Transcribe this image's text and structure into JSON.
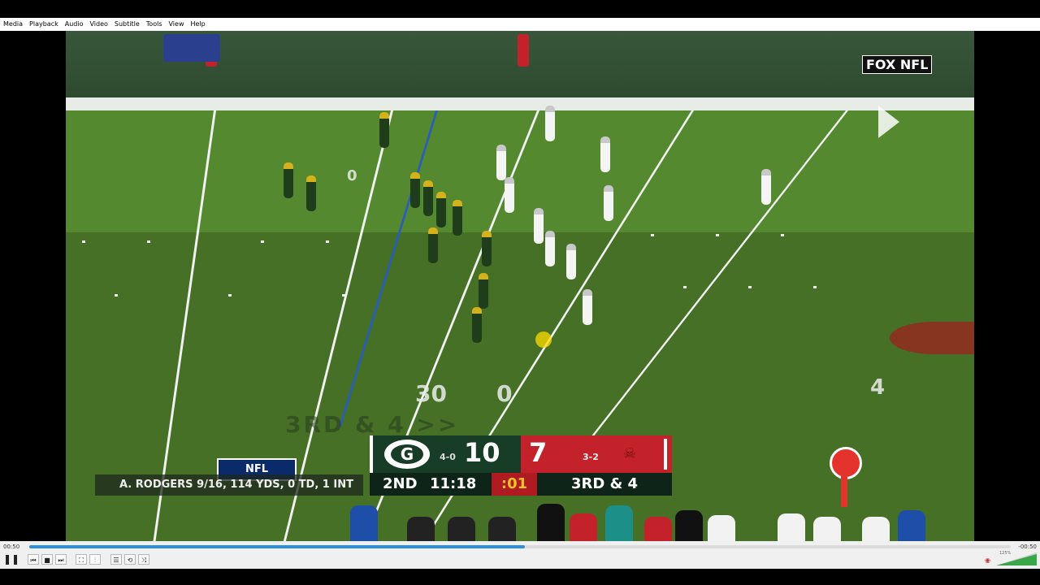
{
  "menu": [
    "Media",
    "Playback",
    "Audio",
    "Video",
    "Subtitle",
    "Tools",
    "View",
    "Help"
  ],
  "broadcast": {
    "network_logo": "FOX NFL",
    "field_text": "3RD & 4 >>",
    "yard_numbers": [
      "0",
      "30",
      "4",
      "0"
    ],
    "player_stat": "A. RODGERS 9/16, 114 YDS, 0 TD, 1 INT",
    "league_logo": "NFL",
    "home_team": {
      "logo_letter": "G",
      "record": "4-0",
      "score": "10",
      "color": "#173d26"
    },
    "away_team": {
      "record": "3-2",
      "score": "7",
      "color": "#c3222b"
    },
    "quarter": "2ND",
    "game_clock": "11:18",
    "play_clock": ":01",
    "down_distance": "3RD & 4"
  },
  "player_controls": {
    "time_elapsed": "00:50",
    "time_total": "-00:50",
    "progress": 0.505,
    "volume_label": "125%",
    "buttons": {
      "play_pause": "pause-icon",
      "prev": "previous-icon",
      "stop": "stop-icon",
      "next": "next-icon",
      "fullscreen": "fullscreen-icon",
      "extended": "equalizer-icon",
      "playlist": "playlist-icon",
      "loop": "loop-icon",
      "random": "shuffle-icon"
    }
  },
  "colors": {
    "accent": "#2f8fdb",
    "field": "#55892f"
  }
}
